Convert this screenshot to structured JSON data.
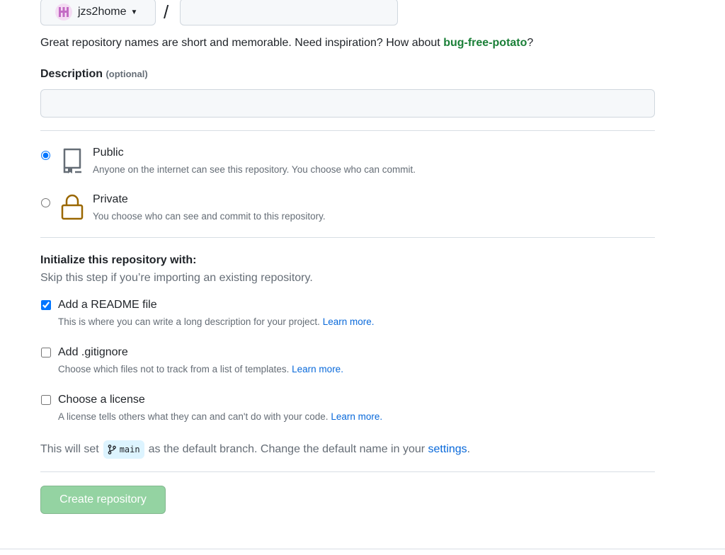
{
  "owner": {
    "name": "jzs2home"
  },
  "separator": "/",
  "repo_name": {
    "value": "",
    "placeholder": ""
  },
  "hint": {
    "prefix": "Great repository names are short and memorable. Need inspiration? How about ",
    "suggestion": "bug-free-potato",
    "suffix": "?"
  },
  "description": {
    "label": "Description",
    "optional": "(optional)",
    "value": "",
    "placeholder": ""
  },
  "visibility": [
    {
      "title": "Public",
      "desc": "Anyone on the internet can see this repository. You choose who can commit.",
      "checked": true,
      "icon": "repo-icon"
    },
    {
      "title": "Private",
      "desc": "You choose who can see and commit to this repository.",
      "checked": false,
      "icon": "lock-icon"
    }
  ],
  "init": {
    "title": "Initialize this repository with:",
    "subtitle": "Skip this step if you’re importing an existing repository.",
    "options": [
      {
        "title": "Add a README file",
        "desc": "This is where you can write a long description for your project.",
        "link": "Learn more.",
        "checked": true
      },
      {
        "title": "Add .gitignore",
        "desc": "Choose which files not to track from a list of templates.",
        "link": "Learn more.",
        "checked": false
      },
      {
        "title": "Choose a license",
        "desc": "A license tells others what they can and can't do with your code.",
        "link": "Learn more.",
        "checked": false
      }
    ]
  },
  "branch": {
    "prefix": "This will set",
    "name": "main",
    "middle": "as the default branch. Change the default name in your",
    "link": "settings",
    "suffix": "."
  },
  "create_button": "Create repository",
  "colors": {
    "accent_green": "#1a7f37",
    "link_blue": "#0969da",
    "button_disabled": "#94d3a2",
    "lock_gold": "#9a6700"
  }
}
